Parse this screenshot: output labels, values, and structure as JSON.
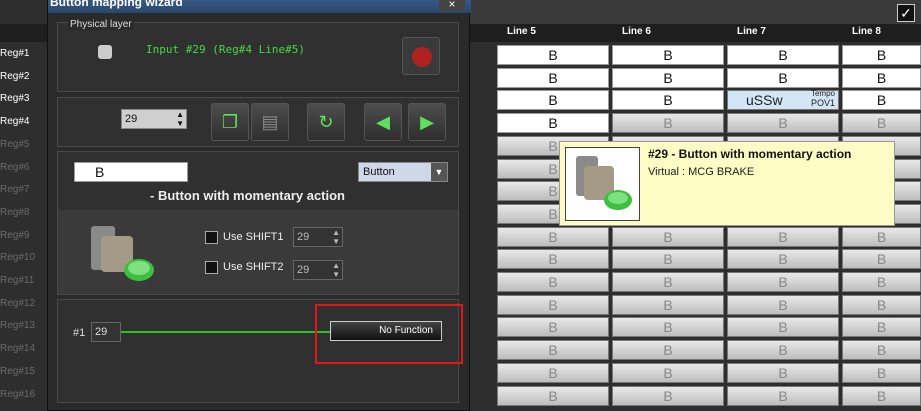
{
  "wizard": {
    "title": "Button mapping wizard",
    "close": "×",
    "physical_layer_label": "Physical layer",
    "input_text": "Input #29 (Reg#4  Line#5)",
    "input_number": "29",
    "mapping_value": "B",
    "type_select": "Button",
    "description": "- Button with momentary action",
    "shift1_label": "Use SHIFT1",
    "shift1_value": "29",
    "shift2_label": "Use SHIFT2",
    "shift2_value": "29",
    "chain_index": "#1",
    "chain_value": "29",
    "no_function_label": "No Function"
  },
  "grid": {
    "columns": [
      "Line 5",
      "Line 6",
      "Line 7",
      "Line 8"
    ],
    "rows": [
      "Reg#1",
      "Reg#2",
      "Reg#3",
      "Reg#4",
      "Reg#5",
      "Reg#6",
      "Reg#7",
      "Reg#8",
      "Reg#9",
      "Reg#10",
      "Reg#11",
      "Reg#12",
      "Reg#13",
      "Reg#14",
      "Reg#15",
      "Reg#16"
    ],
    "active_rows": 3,
    "cell_value": "B",
    "special_cell": {
      "main": "uSSw",
      "top": "Tempo",
      "bottom": "POV1"
    },
    "header_check": "✓"
  },
  "tooltip": {
    "title": "#29 - Button with momentary action",
    "subtitle": "Virtual : MCG BRAKE"
  },
  "colors": {
    "accent_green": "#45d845",
    "highlight_red": "#e01818",
    "tooltip_bg": "#fdfcc4"
  }
}
